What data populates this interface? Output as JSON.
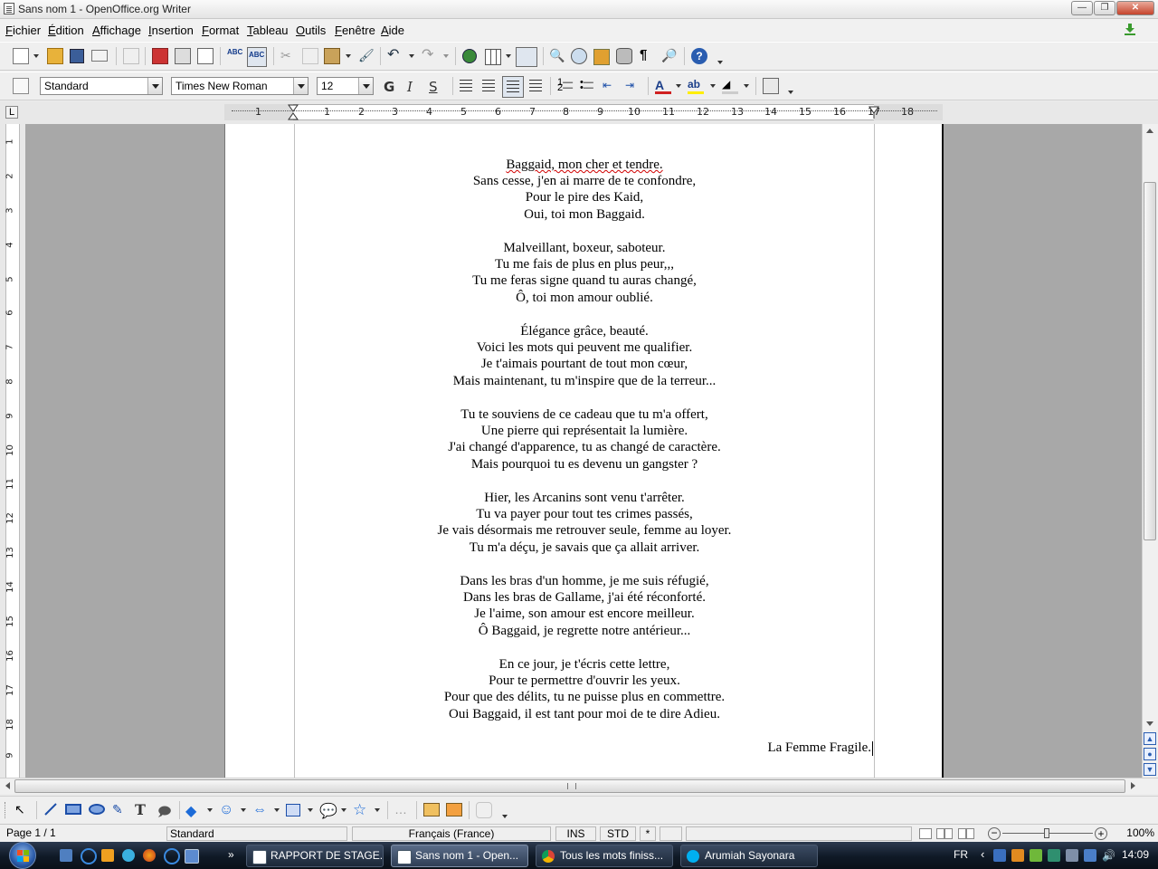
{
  "window": {
    "title": "Sans nom 1 - OpenOffice.org Writer"
  },
  "menu": [
    "Fichier",
    "Édition",
    "Affichage",
    "Insertion",
    "Format",
    "Tableau",
    "Outils",
    "Fenêtre",
    "Aide"
  ],
  "formatting": {
    "style": "Standard",
    "font": "Times New Roman",
    "size": "12"
  },
  "ruler_numbers": [
    "1",
    "1",
    "2",
    "3",
    "4",
    "5",
    "6",
    "7",
    "8",
    "9",
    "10",
    "11",
    "12",
    "13",
    "14",
    "15",
    "16",
    "17",
    "18"
  ],
  "vruler_numbers": [
    "1",
    "2",
    "3",
    "4",
    "5",
    "6",
    "7",
    "8",
    "9",
    "10",
    "11",
    "12",
    "13",
    "14",
    "15",
    "16",
    "17",
    "18",
    "9"
  ],
  "document": {
    "lines": [
      "Baggaid, mon cher et tendre.",
      "Sans cesse, j'en ai marre de te confondre,",
      "Pour le pire des Kaid,",
      "Oui, toi mon Baggaid.",
      "",
      "Malveillant, boxeur, saboteur.",
      "Tu me fais de plus en plus peur,,,",
      "Tu me feras signe quand tu auras changé,",
      "Ô, toi mon amour oublié.",
      "",
      "Élégance grâce, beauté.",
      "Voici les mots qui peuvent me qualifier.",
      "Je t'aimais pourtant de tout mon cœur,",
      "Mais maintenant, tu m'inspire que de la terreur...",
      "",
      "Tu te souviens de ce cadeau que tu m'a offert,",
      "Une pierre qui représentait la lumière.",
      "J'ai changé d'apparence, tu as changé de caractère.",
      "Mais pourquoi tu es devenu un gangster ?",
      "",
      "Hier, les Arcanins sont venu t'arrêter.",
      "Tu va payer pour tout tes crimes passés,",
      "Je vais désormais me retrouver seule, femme au loyer.",
      "Tu m'a déçu, je savais que ça allait arriver.",
      "",
      "Dans les bras d'un homme, je me suis réfugié,",
      "Dans les bras de Gallame, j'ai été réconforté.",
      "Je l'aime, son amour est encore meilleur.",
      "Ô Baggaid, je regrette notre antérieur...",
      "",
      "En ce jour, je t'écris cette lettre,",
      "Pour te permettre d'ouvrir les yeux.",
      "Pour que des délits, tu ne puisse plus en commettre.",
      "Oui Baggaid, il est tant pour moi de te dire Adieu."
    ],
    "signature": "La Femme Fragile."
  },
  "status": {
    "page": "Page 1 / 1",
    "style": "Standard",
    "language": "Français (France)",
    "insert_mode": "INS",
    "selection_mode": "STD",
    "modified": "*",
    "zoom": "100%"
  },
  "taskbar": {
    "tasks": [
      {
        "label": "RAPPORT DE STAGE...",
        "icon": "writer-icon"
      },
      {
        "label": "Sans nom 1 - Open...",
        "icon": "writer-icon"
      },
      {
        "label": "Tous les mots finiss...",
        "icon": "chrome-icon"
      },
      {
        "label": "Arumiah Sayonara",
        "icon": "skype-icon"
      }
    ],
    "language": "FR",
    "clock": "14:09"
  },
  "colors": {
    "taskbar": "#0f1926",
    "workspace": "#a8a8a8",
    "spellcheck": "#d00000"
  }
}
